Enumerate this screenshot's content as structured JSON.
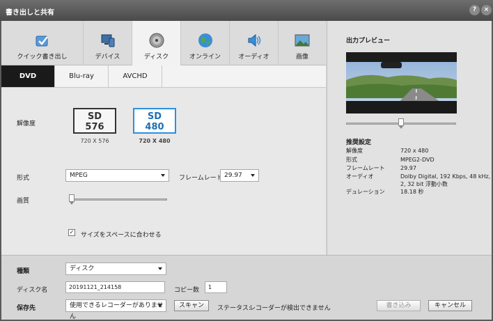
{
  "window": {
    "title": "書き出しと共有",
    "help": "?",
    "close": "×"
  },
  "category_tabs": [
    {
      "label": "クイック書き出し",
      "icon": "quick-export-icon",
      "active": false
    },
    {
      "label": "デバイス",
      "icon": "device-icon",
      "active": false
    },
    {
      "label": "ディスク",
      "icon": "disc-icon",
      "active": true
    },
    {
      "label": "オンライン",
      "icon": "globe-icon",
      "active": false
    },
    {
      "label": "オーディオ",
      "icon": "speaker-icon",
      "active": false
    },
    {
      "label": "画像",
      "icon": "image-icon",
      "active": false
    }
  ],
  "format_tabs": [
    {
      "label": "DVD",
      "active": true
    },
    {
      "label": "Blu-ray",
      "active": false
    },
    {
      "label": "AVCHD",
      "active": false
    }
  ],
  "resolution": {
    "label": "解像度",
    "options": [
      {
        "line1": "SD",
        "line2": "576",
        "caption": "720 X 576",
        "selected": false
      },
      {
        "line1": "SD",
        "line2": "480",
        "caption": "720 X 480",
        "selected": true
      }
    ]
  },
  "format": {
    "label": "形式",
    "value": "MPEG"
  },
  "framerate": {
    "label": "フレームレート",
    "value": "29.97"
  },
  "quality": {
    "label": "画質",
    "level": 0.0
  },
  "fit_to_space": {
    "label": "サイズをスペースに合わせる",
    "checked": true
  },
  "preview": {
    "title": "出力プレビュー",
    "position": 0.5
  },
  "recommended": {
    "title": "推奨設定",
    "rows": [
      {
        "key": "解像度",
        "value": "720 x 480"
      },
      {
        "key": "形式",
        "value": "MPEG2-DVD"
      },
      {
        "key": "フレームレート",
        "value": "29.97"
      },
      {
        "key": "オーディオ",
        "value": "Dolby Digital, 192 Kbps, 48 kHz, 2, 32 bit 浮動小数"
      },
      {
        "key": "デュレーション",
        "value": "18.18 秒"
      }
    ]
  },
  "bottom": {
    "type": {
      "label": "種類",
      "value": "ディスク"
    },
    "disc_name": {
      "label": "ディスク名",
      "value": "20191121_214158"
    },
    "copies": {
      "label": "コピー数",
      "value": "1"
    },
    "save_to": {
      "label": "保存先",
      "value": "使用できるレコーダーがありません"
    },
    "scan_label": "スキャン",
    "status_label": "ステータス:",
    "status_value": "レコーダーが検出できません",
    "write_label": "書き込み",
    "cancel_label": "キャンセル"
  },
  "colors": {
    "accent": "#2b8fe0",
    "active_tab": "#1a1a1a"
  }
}
